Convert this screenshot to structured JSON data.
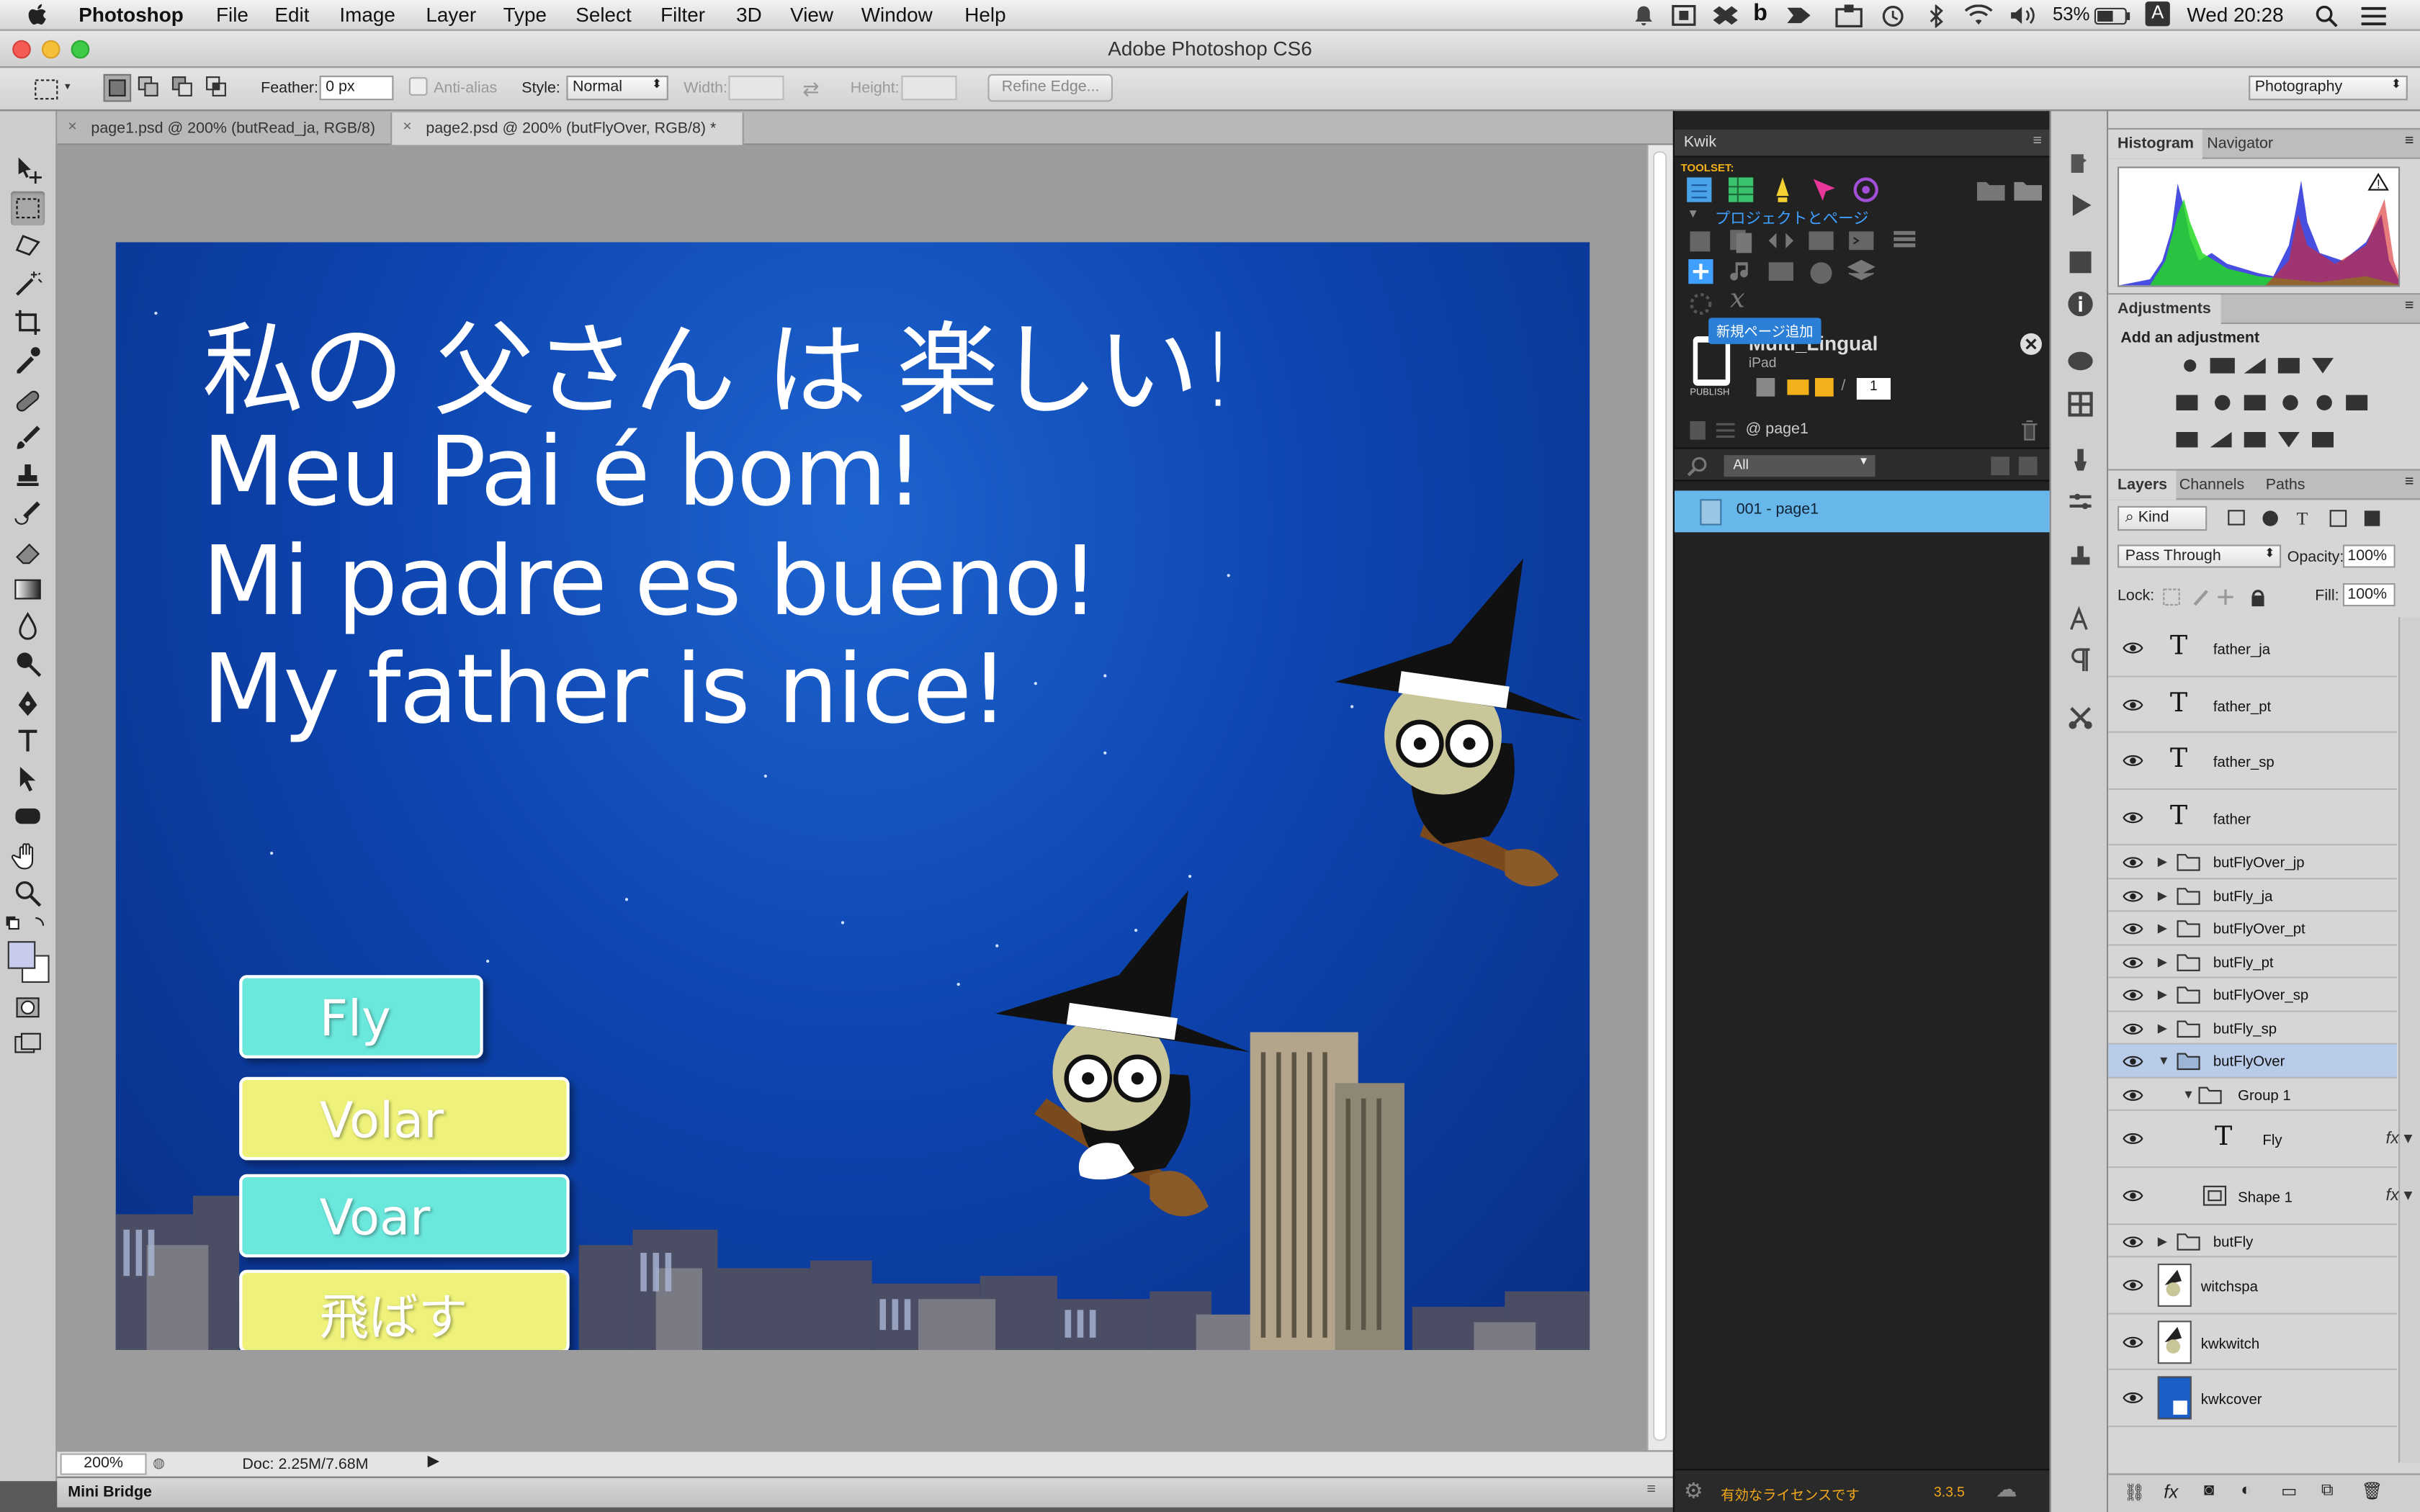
{
  "menubar": {
    "app_name": "Photoshop",
    "items": [
      "File",
      "Edit",
      "Image",
      "Layer",
      "Type",
      "Select",
      "Filter",
      "3D",
      "View",
      "Window",
      "Help"
    ],
    "battery": "53%",
    "input_source": "A",
    "clock": "Wed 20:28"
  },
  "window": {
    "title": "Adobe Photoshop CS6"
  },
  "options": {
    "feather_label": "Feather:",
    "feather_value": "0 px",
    "antialias_label": "Anti-alias",
    "style_label": "Style:",
    "style_value": "Normal",
    "width_label": "Width:",
    "height_label": "Height:",
    "refine_label": "Refine Edge...",
    "workspace": "Photography"
  },
  "tabs": [
    {
      "label": "page1.psd @ 200% (butRead_ja, RGB/8)"
    },
    {
      "label": "page2.psd @ 200% (butFlyOver, RGB/8) *"
    }
  ],
  "artwork": {
    "lines": [
      "私の 父さん は 楽しい!",
      "Meu Pai é bom!",
      "Mi padre es bueno!",
      "My father is nice!"
    ],
    "buttons": [
      {
        "label": "Fly",
        "color": "#6be8dc"
      },
      {
        "label": "Volar",
        "color": "#eef27a"
      },
      {
        "label": "Voar",
        "color": "#6be8dc"
      },
      {
        "label": "飛ばす",
        "color": "#eef27a"
      }
    ]
  },
  "status": {
    "zoom": "200%",
    "doc": "Doc: 2.25M/7.68M"
  },
  "minibridge": {
    "label": "Mini Bridge"
  },
  "kwik": {
    "title": "Kwik",
    "toolset_label": "TOOLSET:",
    "section_label": "プロジェクトとページ",
    "tooltip": "新規ページ追加",
    "project_name": "Multi_Lingual",
    "device": "iPad",
    "publish_label": "PUBLISH",
    "page_number": "1",
    "current_page": "@ page1",
    "filter_value": "All",
    "page_item": "001 - page1",
    "license_text": "有効なライセンスです",
    "version": "3.3.5"
  },
  "panels": {
    "top_tabs": [
      "Histogram",
      "Navigator"
    ],
    "adjustments_title": "Adjustments",
    "adjustments_hint": "Add an adjustment",
    "layer_tabs": [
      "Layers",
      "Channels",
      "Paths"
    ],
    "kind_label": "Kind",
    "blend_mode": "Pass Through",
    "opacity_label": "Opacity:",
    "opacity_value": "100%",
    "lock_label": "Lock:",
    "fill_label": "Fill:",
    "fill_value": "100%"
  },
  "layers": [
    {
      "name": "father_ja",
      "type": "text"
    },
    {
      "name": "father_pt",
      "type": "text"
    },
    {
      "name": "father_sp",
      "type": "text"
    },
    {
      "name": "father",
      "type": "text"
    },
    {
      "name": "butFlyOver_jp",
      "type": "group"
    },
    {
      "name": "butFly_ja",
      "type": "group"
    },
    {
      "name": "butFlyOver_pt",
      "type": "group"
    },
    {
      "name": "butFly_pt",
      "type": "group"
    },
    {
      "name": "butFlyOver_sp",
      "type": "group"
    },
    {
      "name": "butFly_sp",
      "type": "group"
    },
    {
      "name": "butFlyOver",
      "type": "group-open",
      "selected": true
    },
    {
      "name": "Group 1",
      "type": "subgroup"
    },
    {
      "name": "Fly",
      "type": "text-child"
    },
    {
      "name": "Shape 1",
      "type": "shape-child"
    },
    {
      "name": "butFly",
      "type": "group"
    },
    {
      "name": "witchspa",
      "type": "image"
    },
    {
      "name": "kwkwitch",
      "type": "image"
    },
    {
      "name": "kwkcover",
      "type": "image"
    }
  ],
  "colors": {
    "accent": "#5fb2e8",
    "canvas_blue": "#0d45b0",
    "selection": "#b8cbe8"
  }
}
